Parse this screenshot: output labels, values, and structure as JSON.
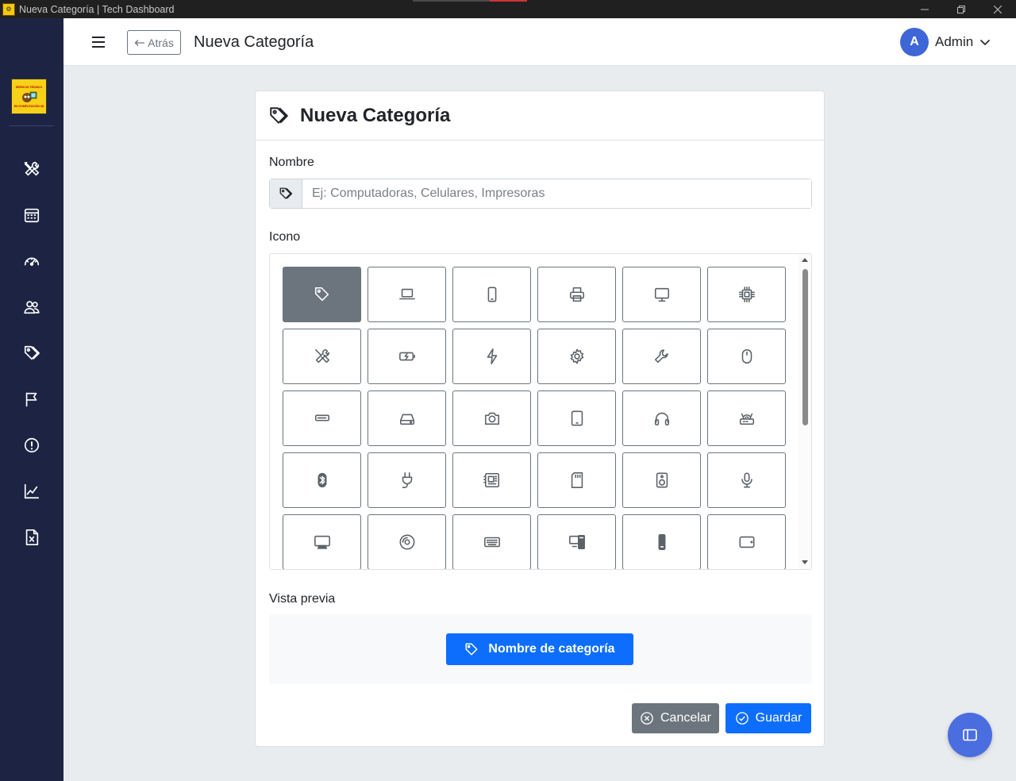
{
  "window": {
    "title": "Nueva Categoría | Tech Dashboard",
    "controls": [
      "minimize-icon",
      "restore-icon",
      "close-icon"
    ]
  },
  "sidebar": {
    "logo": {
      "line1": "SERVICIO TÉCNICO",
      "line2": "EN COMPUTACIÓN 3D"
    },
    "items": [
      {
        "icon": "tools-icon"
      },
      {
        "icon": "calendar-icon"
      },
      {
        "icon": "speedometer-icon"
      },
      {
        "icon": "people-icon"
      },
      {
        "icon": "tags-icon"
      },
      {
        "icon": "flag-icon"
      },
      {
        "icon": "exclamation-circle-icon"
      },
      {
        "icon": "graph-up-icon"
      },
      {
        "icon": "file-excel-icon"
      }
    ]
  },
  "topbar": {
    "back_label": "Atrás",
    "title": "Nueva Categoría",
    "user": {
      "initial": "A",
      "name": "Admin"
    }
  },
  "form": {
    "card_title": "Nueva Categoría",
    "name_label": "Nombre",
    "name_placeholder": "Ej: Computadoras, Celulares, Impresoras",
    "name_value": "",
    "icon_label": "Icono",
    "selected_icon": "tag",
    "icons": [
      "tag",
      "laptop",
      "phone",
      "printer",
      "display",
      "cpu",
      "tools",
      "battery-charging",
      "lightning",
      "gear",
      "wrench",
      "mouse",
      "hdd-stack",
      "hdd",
      "camera",
      "tablet",
      "headphones",
      "router",
      "bluetooth",
      "plug",
      "motherboard",
      "sd-card",
      "speaker",
      "mic",
      "pc-display",
      "disc",
      "keyboard",
      "devices",
      "phone-landscape",
      "tablet-landscape"
    ],
    "preview_label": "Vista previa",
    "preview_badge": "Nombre de categoría",
    "cancel_label": "Cancelar",
    "save_label": "Guardar"
  },
  "colors": {
    "sidebar": "#1d2443",
    "primary": "#0d6efd",
    "secondary": "#6c757d",
    "avatar": "#3f66d6"
  }
}
